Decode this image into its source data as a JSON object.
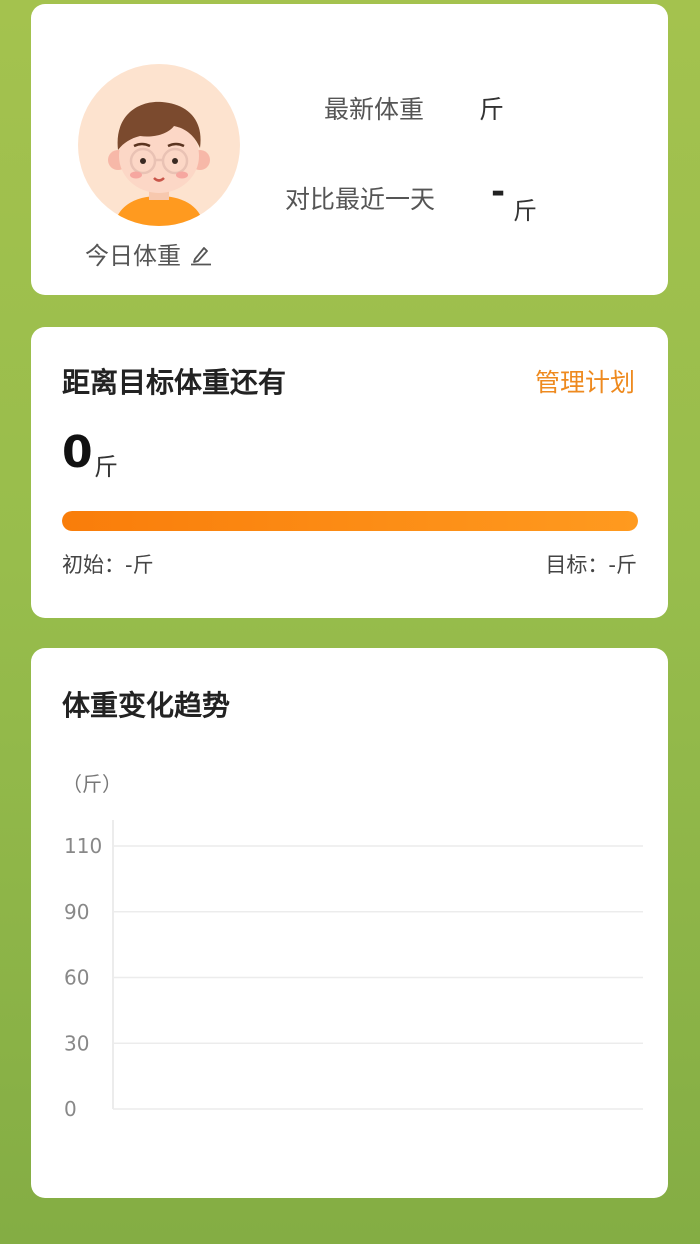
{
  "profile": {
    "today_weight_label": "今日体重",
    "latest_weight_label": "最新体重",
    "latest_weight_unit": "斤",
    "compare_label": "对比最近一天",
    "compare_value": "-",
    "compare_unit": "斤",
    "icons": {
      "avatar": "avatar-boy-glasses",
      "edit": "pencil-icon"
    }
  },
  "goal": {
    "title": "距离目标体重还有",
    "manage_plan": "管理计划",
    "remaining_value": "0",
    "remaining_unit": "斤",
    "progress": 1.0,
    "start_label": "初始：-斤",
    "target_label": "目标：-斤"
  },
  "trend": {
    "title": "体重变化趋势",
    "unit_label": "（斤）"
  },
  "colors": {
    "accent": "#ee8a1f",
    "progress": "#f97d0a",
    "background": "#9cbf4c",
    "card": "#ffffff"
  },
  "chart_data": {
    "type": "line",
    "title": "",
    "xlabel": "",
    "ylabel": "（斤）",
    "y_ticks": [
      "0",
      "30",
      "60",
      "90",
      "110"
    ],
    "ylim": [
      0,
      110
    ],
    "grid": true,
    "series": []
  }
}
